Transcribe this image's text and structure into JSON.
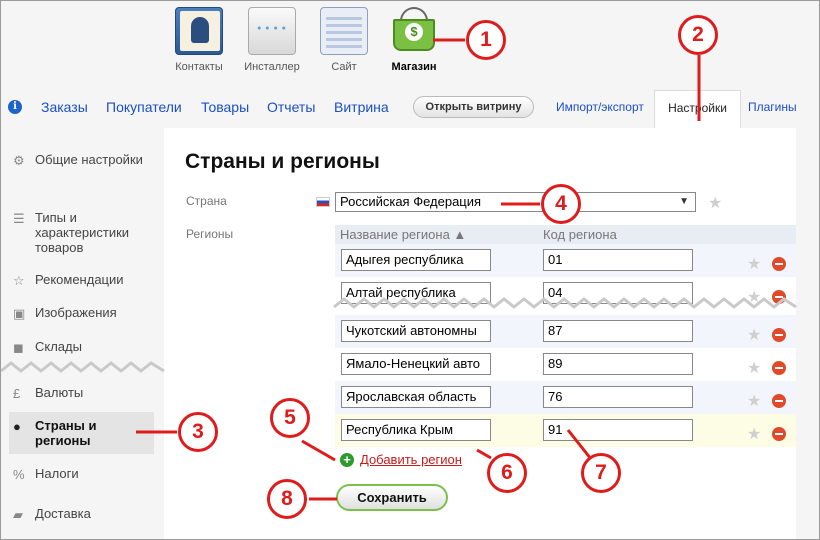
{
  "apps": [
    {
      "label": "Контакты",
      "icon": "contacts-icon"
    },
    {
      "label": "Инсталлер",
      "icon": "installer-icon"
    },
    {
      "label": "Сайт",
      "icon": "site-icon"
    },
    {
      "label": "Магазин",
      "icon": "shop-basket-icon",
      "active": true
    }
  ],
  "nav": {
    "info": "i",
    "links": [
      "Заказы",
      "Покупатели",
      "Товары",
      "Отчеты",
      "Витрина"
    ],
    "open_storefront": "Открыть витрину",
    "import_export": "Импорт/экспорт",
    "settings": "Настройки",
    "plugins": "Плагины"
  },
  "sidebar": {
    "items": [
      {
        "label": "Общие настройки",
        "icon": "gears-icon"
      },
      {
        "label": "Типы и характеристики товаров",
        "icon": "list-icon"
      },
      {
        "label": "Рекомендации",
        "icon": "star-icon"
      },
      {
        "label": "Изображения",
        "icon": "camera-icon"
      },
      {
        "label": "Склады",
        "icon": "box-icon"
      },
      {
        "label": "Валюты",
        "icon": "pound-icon"
      },
      {
        "label": "Страны и регионы",
        "icon": "globe-icon",
        "active": true
      },
      {
        "label": "Налоги",
        "icon": "percent-icon"
      },
      {
        "label": "Доставка",
        "icon": "truck-icon"
      }
    ]
  },
  "main": {
    "title": "Страны и регионы",
    "country_label": "Страна",
    "country_value": "Российская Федерация",
    "regions_label": "Регионы",
    "col_name": "Название региона ▲",
    "col_code": "Код региона",
    "rows": [
      {
        "name": "Адыгея республика",
        "code": "01"
      },
      {
        "name": "Алтай республика",
        "code": "04"
      },
      {
        "name": "Чукотский автономны",
        "code": "87"
      },
      {
        "name": "Ямало-Ненецкий авто",
        "code": "89"
      },
      {
        "name": "Ярославская область",
        "code": "76"
      },
      {
        "name": "Республика Крым",
        "code": "91"
      }
    ],
    "add_region": "Добавить регион",
    "save": "Сохранить"
  },
  "callouts": [
    "1",
    "2",
    "3",
    "4",
    "5",
    "6",
    "7",
    "8"
  ],
  "colors": {
    "accent_red": "#e01b1b",
    "link_blue": "#1b4fc7",
    "save_green": "#7cc04a"
  }
}
